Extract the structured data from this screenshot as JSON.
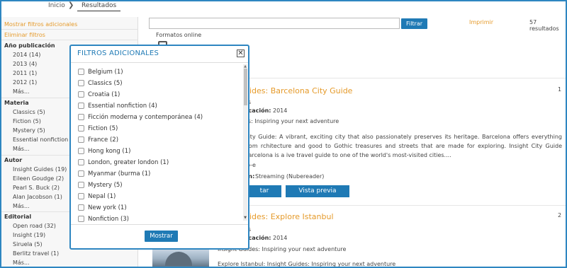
{
  "breadcrumb": {
    "home": "Inicio",
    "separator": "❯",
    "current": "Resultados"
  },
  "sidebar": {
    "show_more_filters": "Mostrar filtros adicionales",
    "remove_filters": "Eliminar filtros",
    "sections": [
      {
        "title": "Año publicación",
        "items": [
          "2014 (14)",
          "2013 (4)",
          "2011 (1)",
          "2012 (1)",
          "Más..."
        ]
      },
      {
        "title": "Materia",
        "items": [
          "Classics (5)",
          "Fiction (5)",
          "Mystery (5)",
          "Essential nonfiction (4)",
          "Más..."
        ]
      },
      {
        "title": "Autor",
        "items": [
          "Insight Guides (19)",
          "Eileen Goudge (2)",
          "Pearl S. Buck (2)",
          "Alan Jacobson (1)",
          "Más..."
        ]
      },
      {
        "title": "Editorial",
        "items": [
          "Open road (32)",
          "Insight (19)",
          "Siruela (5)",
          "Berlitz travel (1)",
          "Más..."
        ]
      }
    ]
  },
  "search": {
    "value": "",
    "filter_button": "Filtrar"
  },
  "toolbar": {
    "print": "Imprimir",
    "count": "57 resultados"
  },
  "formats": {
    "label": "Formatos online"
  },
  "results": [
    {
      "num": "1",
      "title": "uides: Barcelona City Guide",
      "line_authors": "es",
      "line_pub_label": "licación:",
      "line_pub_value": "2014",
      "line_series": "es: Inspiring your next adventure",
      "desc": "City Guide: A vibrant, exciting city that also passionately preserves its heritage. Barcelona offers everything from rchitecture and good to Gothic treasures and streets that are made for exploring. Insight City Guide Barcelona is a ive travel guide to one of the world's most-visited cities....",
      "line_format": "ro-e",
      "line_access_label": "en:",
      "line_access_value": "Streaming (Nubereader)",
      "btn1": "tar",
      "btn2": "Vista previa"
    },
    {
      "num": "2",
      "title": "uides: Explore Istanbul",
      "line_authors": "es",
      "line_pub_label": "licación:",
      "line_pub_value": "2014",
      "line_series": "Insight Guides: Inspiring your next adventure",
      "line_desc": "Explore Istanbul: Insight Guides: Inspiring your next adventure"
    }
  ],
  "modal": {
    "title": "FILTROS ADICIONALES",
    "close": "✕",
    "options": [
      "Belgium (1)",
      "Classics (5)",
      "Croatia (1)",
      "Essential nonfiction (4)",
      "Ficción moderna y contemporánea (4)",
      "Fiction (5)",
      "France (2)",
      "Hong kong (1)",
      "London, greater london (1)",
      "Myanmar (burma (1)",
      "Mystery (5)",
      "Nepal (1)",
      "New york (1)",
      "Nonfiction (3)"
    ],
    "submit": "Mostrar"
  }
}
